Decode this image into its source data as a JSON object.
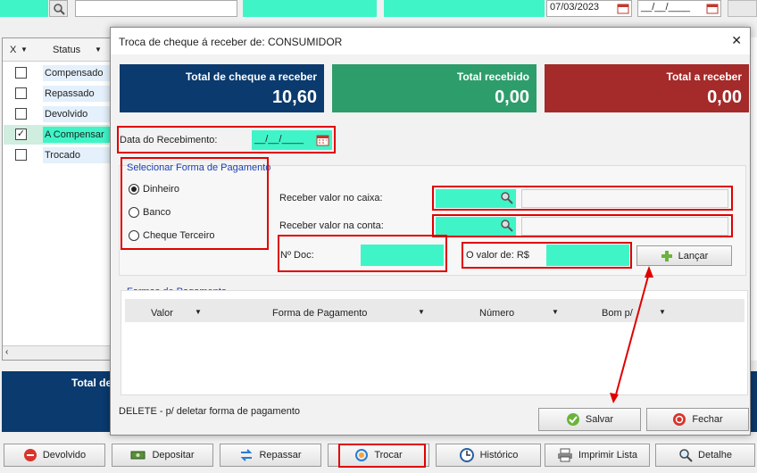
{
  "background_top": {
    "date_value": "07/03/2023",
    "date_empty": "__/__/____"
  },
  "grid": {
    "col_x": "X",
    "col_status": "Status",
    "rows": [
      {
        "status": "Compensado",
        "checked": false
      },
      {
        "status": "Repassado",
        "checked": false
      },
      {
        "status": "Devolvido",
        "checked": false
      },
      {
        "status": "A Compensar",
        "checked": true
      },
      {
        "status": "Trocado",
        "checked": false
      }
    ],
    "total_label": "Total de"
  },
  "dialog": {
    "title": "Troca de cheque á receber de: CONSUMIDOR",
    "close_symbol": "✕",
    "cards": {
      "total_cheque_label": "Total de cheque a receber",
      "total_cheque_value": "10,60",
      "total_recebido_label": "Total recebido",
      "total_recebido_value": "0,00",
      "total_a_receber_label": "Total a receber",
      "total_a_receber_value": "0,00"
    },
    "data_recebimento_label": "Data do Recebimento:",
    "data_recebimento_value": "__/__/____",
    "forma_pagamento": {
      "title": "Selecionar Forma de Pagamento",
      "options": [
        "Dinheiro",
        "Banco",
        "Cheque Terceiro"
      ],
      "selected": "Dinheiro"
    },
    "receber_caixa_label": "Receber valor no caixa:",
    "receber_conta_label": "Receber valor na conta:",
    "num_doc_label": "Nº Doc:",
    "valor_label": "O valor de: R$",
    "lancar_label": "Lançar",
    "formas_title": "Formas de Pagamento",
    "columns": [
      "Valor",
      "Forma de Pagamento",
      "Número",
      "Bom p/"
    ],
    "hint": "DELETE - p/ deletar forma de pagamento",
    "salvar_label": "Salvar",
    "fechar_label": "Fechar"
  },
  "toolbar": {
    "devolvido": "Devolvido",
    "depositar": "Depositar",
    "repassar": "Repassar",
    "trocar": "Trocar",
    "historico": "Histórico",
    "imprimir": "Imprimir Lista",
    "detalhe": "Detalhe"
  },
  "colors": {
    "accent_teal": "#3ff5c8",
    "card_blue": "#0a3a6e",
    "card_green": "#2e9d6c",
    "card_red": "#a52a2a",
    "highlight_red": "#e00000"
  }
}
